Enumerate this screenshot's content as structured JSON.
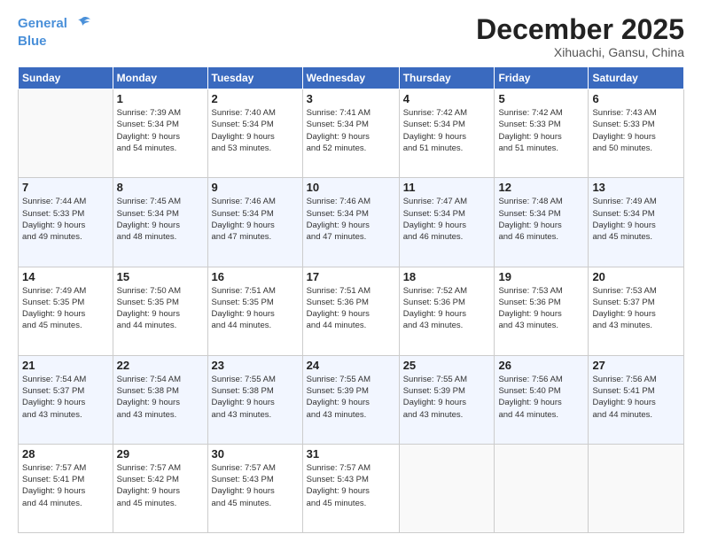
{
  "header": {
    "logo_line1": "General",
    "logo_line2": "Blue",
    "month": "December 2025",
    "location": "Xihuachi, Gansu, China"
  },
  "weekdays": [
    "Sunday",
    "Monday",
    "Tuesday",
    "Wednesday",
    "Thursday",
    "Friday",
    "Saturday"
  ],
  "weeks": [
    [
      {
        "day": "",
        "info": ""
      },
      {
        "day": "1",
        "info": "Sunrise: 7:39 AM\nSunset: 5:34 PM\nDaylight: 9 hours\nand 54 minutes."
      },
      {
        "day": "2",
        "info": "Sunrise: 7:40 AM\nSunset: 5:34 PM\nDaylight: 9 hours\nand 53 minutes."
      },
      {
        "day": "3",
        "info": "Sunrise: 7:41 AM\nSunset: 5:34 PM\nDaylight: 9 hours\nand 52 minutes."
      },
      {
        "day": "4",
        "info": "Sunrise: 7:42 AM\nSunset: 5:34 PM\nDaylight: 9 hours\nand 51 minutes."
      },
      {
        "day": "5",
        "info": "Sunrise: 7:42 AM\nSunset: 5:33 PM\nDaylight: 9 hours\nand 51 minutes."
      },
      {
        "day": "6",
        "info": "Sunrise: 7:43 AM\nSunset: 5:33 PM\nDaylight: 9 hours\nand 50 minutes."
      }
    ],
    [
      {
        "day": "7",
        "info": "Sunrise: 7:44 AM\nSunset: 5:33 PM\nDaylight: 9 hours\nand 49 minutes."
      },
      {
        "day": "8",
        "info": "Sunrise: 7:45 AM\nSunset: 5:34 PM\nDaylight: 9 hours\nand 48 minutes."
      },
      {
        "day": "9",
        "info": "Sunrise: 7:46 AM\nSunset: 5:34 PM\nDaylight: 9 hours\nand 47 minutes."
      },
      {
        "day": "10",
        "info": "Sunrise: 7:46 AM\nSunset: 5:34 PM\nDaylight: 9 hours\nand 47 minutes."
      },
      {
        "day": "11",
        "info": "Sunrise: 7:47 AM\nSunset: 5:34 PM\nDaylight: 9 hours\nand 46 minutes."
      },
      {
        "day": "12",
        "info": "Sunrise: 7:48 AM\nSunset: 5:34 PM\nDaylight: 9 hours\nand 46 minutes."
      },
      {
        "day": "13",
        "info": "Sunrise: 7:49 AM\nSunset: 5:34 PM\nDaylight: 9 hours\nand 45 minutes."
      }
    ],
    [
      {
        "day": "14",
        "info": "Sunrise: 7:49 AM\nSunset: 5:35 PM\nDaylight: 9 hours\nand 45 minutes."
      },
      {
        "day": "15",
        "info": "Sunrise: 7:50 AM\nSunset: 5:35 PM\nDaylight: 9 hours\nand 44 minutes."
      },
      {
        "day": "16",
        "info": "Sunrise: 7:51 AM\nSunset: 5:35 PM\nDaylight: 9 hours\nand 44 minutes."
      },
      {
        "day": "17",
        "info": "Sunrise: 7:51 AM\nSunset: 5:36 PM\nDaylight: 9 hours\nand 44 minutes."
      },
      {
        "day": "18",
        "info": "Sunrise: 7:52 AM\nSunset: 5:36 PM\nDaylight: 9 hours\nand 43 minutes."
      },
      {
        "day": "19",
        "info": "Sunrise: 7:53 AM\nSunset: 5:36 PM\nDaylight: 9 hours\nand 43 minutes."
      },
      {
        "day": "20",
        "info": "Sunrise: 7:53 AM\nSunset: 5:37 PM\nDaylight: 9 hours\nand 43 minutes."
      }
    ],
    [
      {
        "day": "21",
        "info": "Sunrise: 7:54 AM\nSunset: 5:37 PM\nDaylight: 9 hours\nand 43 minutes."
      },
      {
        "day": "22",
        "info": "Sunrise: 7:54 AM\nSunset: 5:38 PM\nDaylight: 9 hours\nand 43 minutes."
      },
      {
        "day": "23",
        "info": "Sunrise: 7:55 AM\nSunset: 5:38 PM\nDaylight: 9 hours\nand 43 minutes."
      },
      {
        "day": "24",
        "info": "Sunrise: 7:55 AM\nSunset: 5:39 PM\nDaylight: 9 hours\nand 43 minutes."
      },
      {
        "day": "25",
        "info": "Sunrise: 7:55 AM\nSunset: 5:39 PM\nDaylight: 9 hours\nand 43 minutes."
      },
      {
        "day": "26",
        "info": "Sunrise: 7:56 AM\nSunset: 5:40 PM\nDaylight: 9 hours\nand 44 minutes."
      },
      {
        "day": "27",
        "info": "Sunrise: 7:56 AM\nSunset: 5:41 PM\nDaylight: 9 hours\nand 44 minutes."
      }
    ],
    [
      {
        "day": "28",
        "info": "Sunrise: 7:57 AM\nSunset: 5:41 PM\nDaylight: 9 hours\nand 44 minutes."
      },
      {
        "day": "29",
        "info": "Sunrise: 7:57 AM\nSunset: 5:42 PM\nDaylight: 9 hours\nand 45 minutes."
      },
      {
        "day": "30",
        "info": "Sunrise: 7:57 AM\nSunset: 5:43 PM\nDaylight: 9 hours\nand 45 minutes."
      },
      {
        "day": "31",
        "info": "Sunrise: 7:57 AM\nSunset: 5:43 PM\nDaylight: 9 hours\nand 45 minutes."
      },
      {
        "day": "",
        "info": ""
      },
      {
        "day": "",
        "info": ""
      },
      {
        "day": "",
        "info": ""
      }
    ]
  ]
}
